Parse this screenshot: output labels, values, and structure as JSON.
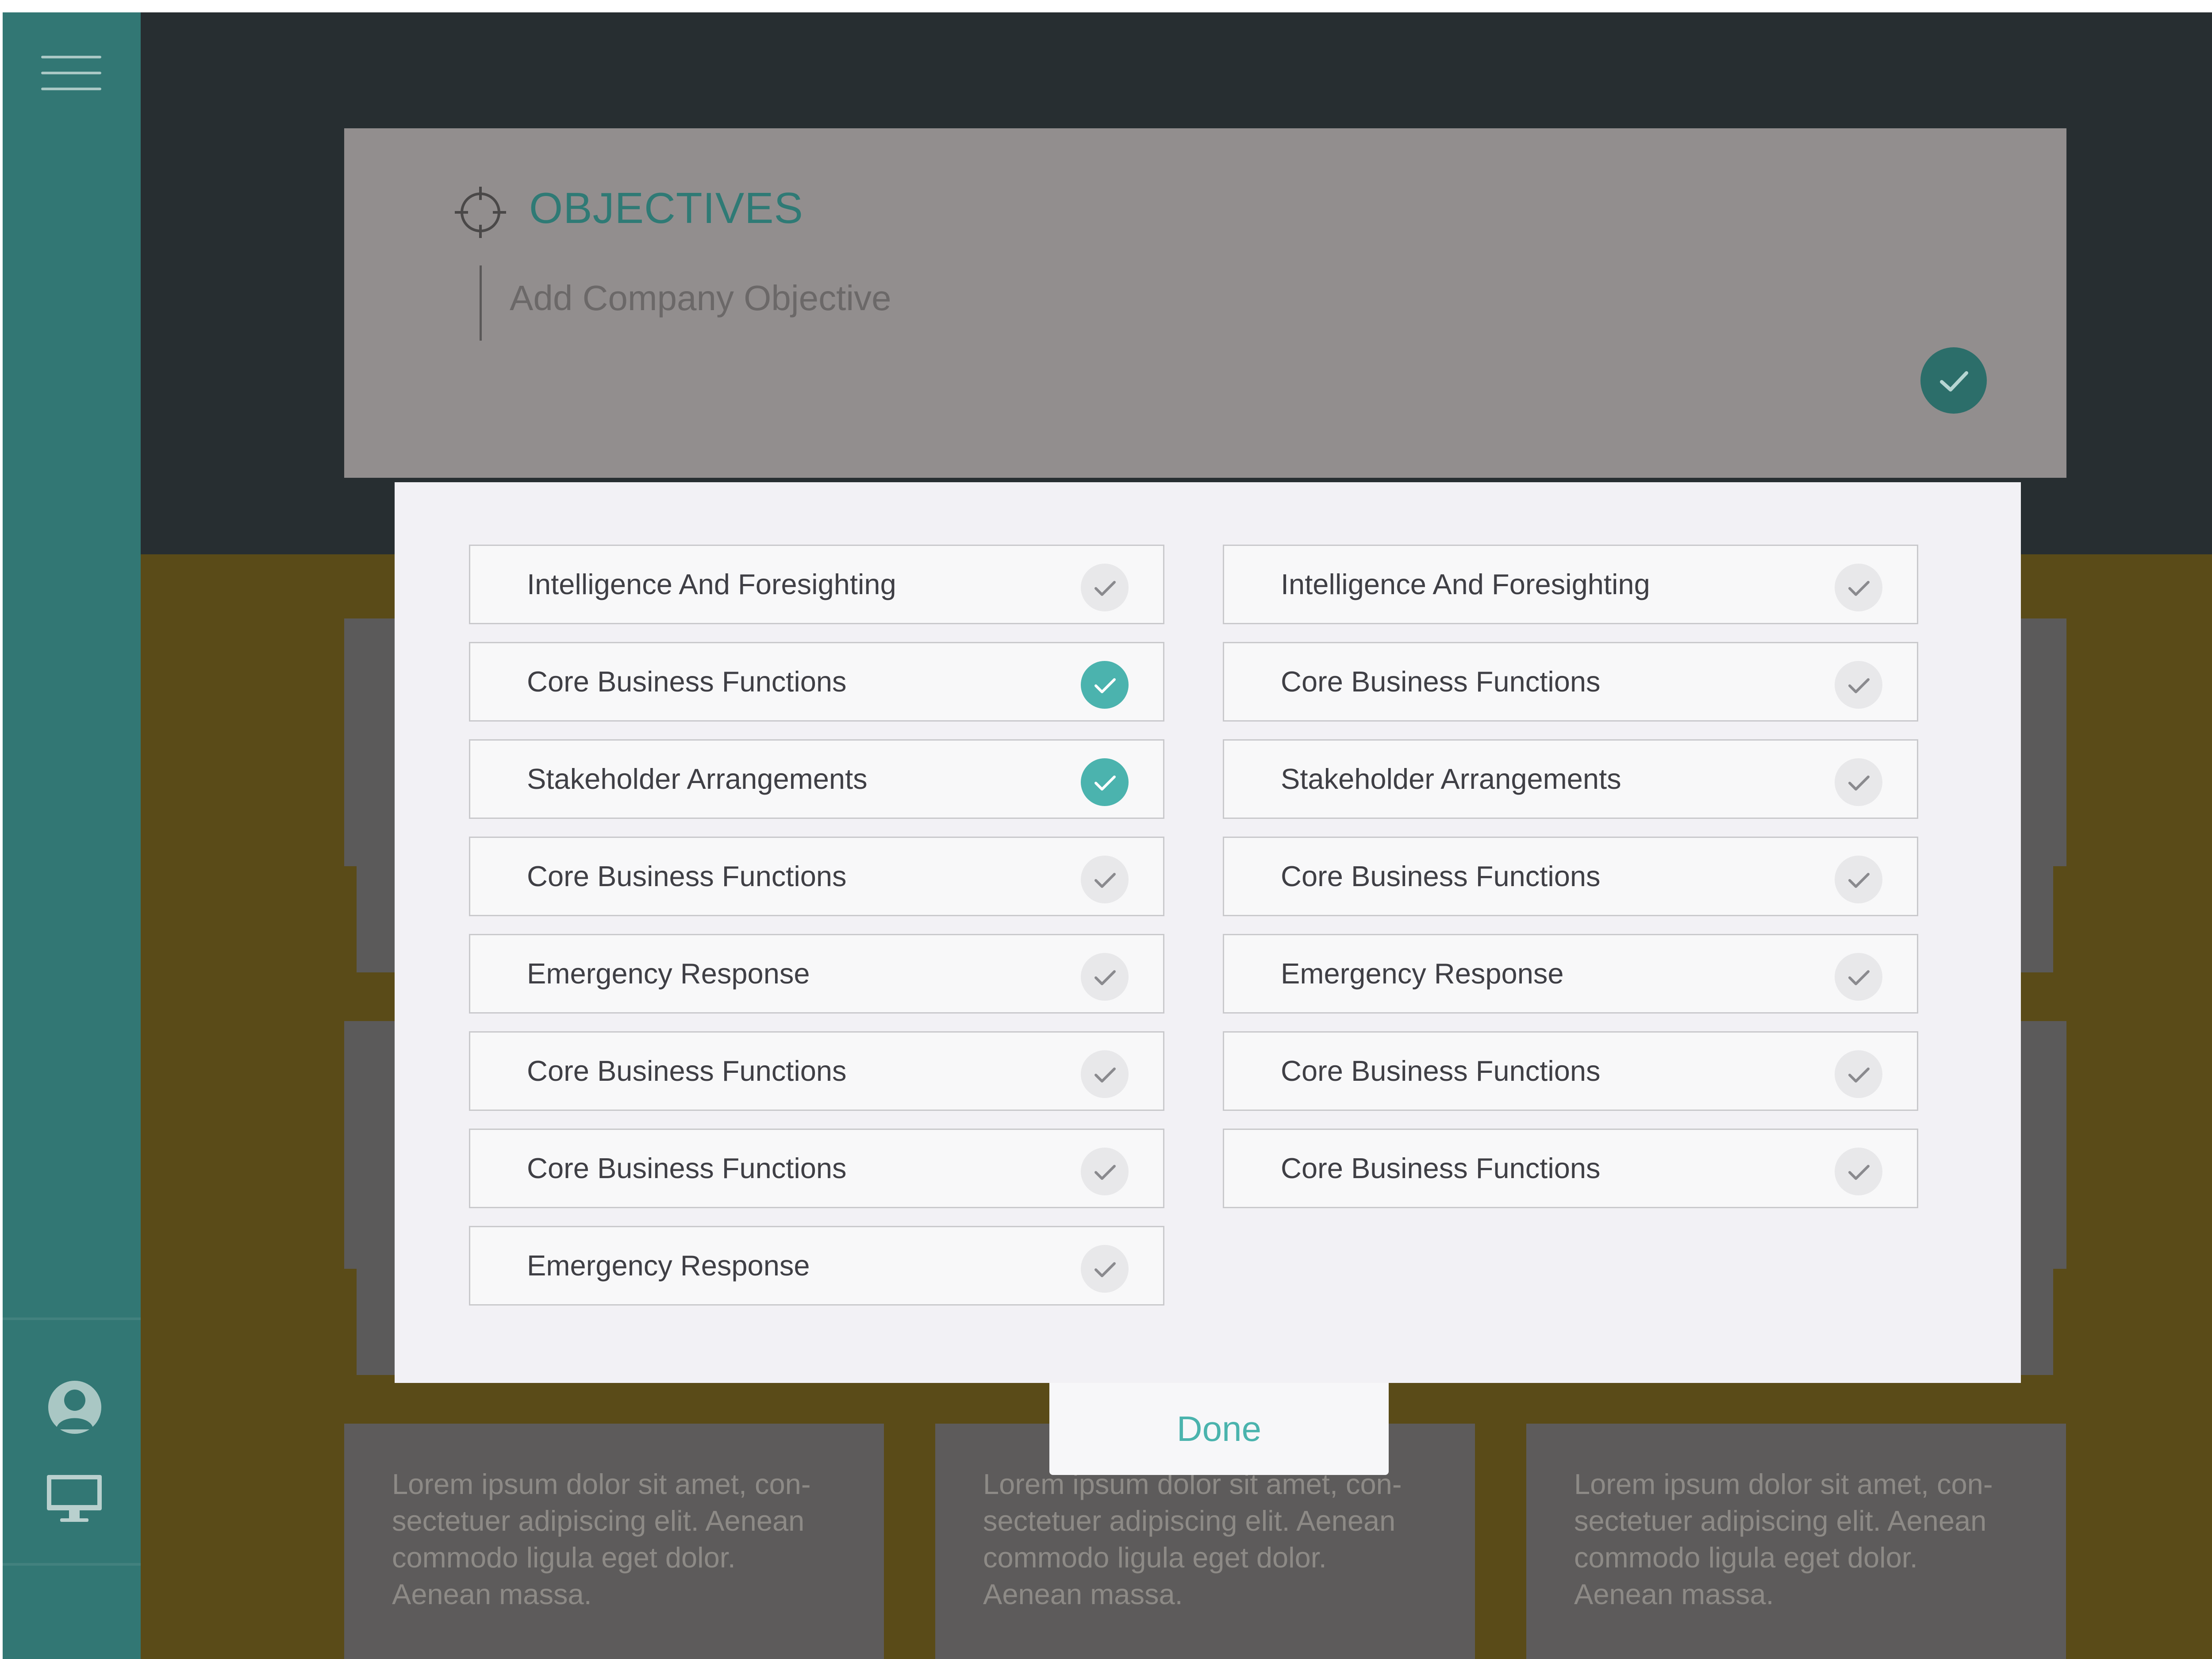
{
  "sidebar": {
    "menu_icon": "hamburger-menu-icon",
    "user_icon": "user-icon",
    "monitor_icon": "monitor-icon"
  },
  "objectives": {
    "icon": "target-icon",
    "title": "OBJECTIVES",
    "input_placeholder": "Add Company Objective",
    "confirm_icon": "check-icon"
  },
  "modal": {
    "left_items": [
      {
        "label": "Intelligence And Foresighting",
        "checked": false
      },
      {
        "label": "Core Business Functions",
        "checked": true
      },
      {
        "label": "Stakeholder Arrangements",
        "checked": true
      },
      {
        "label": "Core Business Functions",
        "checked": false
      },
      {
        "label": "Emergency Response",
        "checked": false
      },
      {
        "label": "Core Business Functions",
        "checked": false
      },
      {
        "label": "Core Business Functions",
        "checked": false
      },
      {
        "label": "Emergency Response",
        "checked": false
      }
    ],
    "right_items": [
      {
        "label": "Intelligence And Foresighting",
        "checked": false
      },
      {
        "label": "Core Business Functions",
        "checked": false
      },
      {
        "label": "Stakeholder Arrangements",
        "checked": false
      },
      {
        "label": "Core Business Functions",
        "checked": false
      },
      {
        "label": "Emergency Response",
        "checked": false
      },
      {
        "label": "Core Business Functions",
        "checked": false
      },
      {
        "label": "Core Business Functions",
        "checked": false
      }
    ],
    "done_label": "Done"
  },
  "cards": [
    {
      "text": "Lorem ipsum dolor sit amet, con-sectetuer adipiscing elit. Aenean commodo ligula eget dolor. Aenean massa."
    },
    {
      "text": "Lorem ipsum dolor sit amet, con-sectetuer adipiscing elit. Aenean commodo ligula eget dolor. Aenean massa."
    },
    {
      "text": "Lorem ipsum dolor sit amet, con-sectetuer adipiscing elit. Aenean commodo ligula eget dolor. Aenean massa."
    }
  ],
  "colors": {
    "accent": "#4bb3ae",
    "sidebar": "#327774",
    "header_bg": "#272e31",
    "olive_bg": "#5a4b18",
    "title_teal": "#2f7a75"
  }
}
